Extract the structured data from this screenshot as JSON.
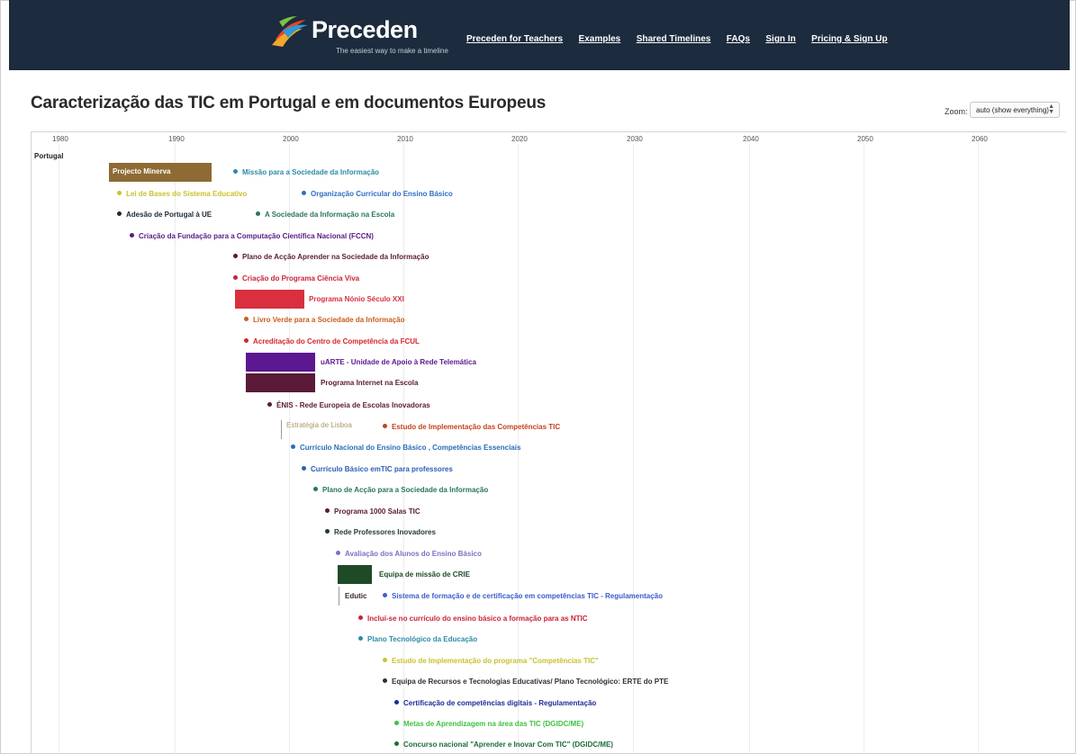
{
  "header": {
    "brand": "Preceden",
    "tagline": "The easiest way to make a timeline",
    "nav": [
      "Preceden for Teachers",
      "Examples",
      "Shared Timelines",
      "FAQs",
      "Sign In",
      "Pricing & Sign Up"
    ]
  },
  "page": {
    "title": "Caracterização das TIC em Portugal e em documentos Europeus",
    "zoom_label": "Zoom:",
    "zoom_value": "auto (show everything)"
  },
  "axis": {
    "ticks": [
      "1980",
      "1990",
      "2000",
      "2010",
      "2020",
      "2030",
      "2040",
      "2050",
      "2060"
    ]
  },
  "lane": "Portugal",
  "events": [
    {
      "label": "Missão para a Sociedade da Informação",
      "color": "#2e8ba8",
      "kind": "point"
    },
    {
      "label": "Lei de Bases do Sistema Educativo",
      "color": "#c8c230",
      "kind": "point"
    },
    {
      "label": "Organização Curricular do Ensino Básico",
      "color": "#2d6fc2",
      "kind": "point"
    },
    {
      "label": "Adesão de Portugal à UE",
      "color": "#1d2a33",
      "kind": "point"
    },
    {
      "label": "A Sociedade da Informação na Escola",
      "color": "#287560",
      "kind": "point"
    },
    {
      "label": "Criação da Fundação para a Computação Científica Nacional (FCCN)",
      "color": "#5b1a86",
      "kind": "point"
    },
    {
      "label": "Plano de Acção Aprender na Sociedade da Informação",
      "color": "#5a1a38",
      "kind": "point"
    },
    {
      "label": "Criação do Programa Ciência Viva",
      "color": "#c9223b",
      "kind": "point"
    },
    {
      "label": "Livro Verde para a Sociedade da Informação",
      "color": "#cc5c1c",
      "kind": "point"
    },
    {
      "label": "Acreditação do Centro de Competência da FCUL",
      "color": "#d8242c",
      "kind": "point"
    },
    {
      "label": "ÉNIS - Rede Europeia de Escolas Inovadoras",
      "color": "#5a1a38",
      "kind": "point"
    },
    {
      "label": "Estudo de Implementação das Competências TIC",
      "color": "#c5431d",
      "kind": "point"
    },
    {
      "label": "Currículo Nacional do Ensino Básico , Competências Essenciais",
      "color": "#2a6cb8",
      "kind": "point"
    },
    {
      "label": "Currículo Básico emTIC para professores",
      "color": "#2a5fb8",
      "kind": "point"
    },
    {
      "label": "Plano de Acção para a Sociedade da Informação",
      "color": "#287560",
      "kind": "point"
    },
    {
      "label": "Programa 1000 Salas TIC",
      "color": "#5a1a38",
      "kind": "point"
    },
    {
      "label": "Rede Professores Inovadores",
      "color": "#1f3d2a",
      "kind": "point"
    },
    {
      "label": "Avaliação dos Alunos do Ensino Básico",
      "color": "#7b6fc4",
      "kind": "point"
    },
    {
      "label": "Sistema de formação e de certificação em competências TIC - Regulamentação",
      "color": "#3a5cc8",
      "kind": "point"
    },
    {
      "label": "Incluí-se no currículo do ensino básico a formação para as NTIC",
      "color": "#c9223b",
      "kind": "point"
    },
    {
      "label": "Plano Tecnológico da Educação",
      "color": "#2e8ba8",
      "kind": "point"
    },
    {
      "label": "Estudo de Implementação do programa \"Competências TIC\"",
      "color": "#c8c230",
      "kind": "point"
    },
    {
      "label": "Equipa de Recursos e Tecnologias Educativas/ Plano Tecnológico: ERTE do PTE",
      "color": "#2f2f2f",
      "kind": "point"
    },
    {
      "label": "Certificação de competências digitais - Regulamentação",
      "color": "#1c2c96",
      "kind": "point"
    },
    {
      "label": "Metas de Aprendizagem na área das TIC (DGIDC/ME)",
      "color": "#3fc242",
      "kind": "point"
    },
    {
      "label": "Concurso nacional \"Aprender e Inovar Com TIC\" (DGIDC/ME)",
      "color": "#1e6b3a",
      "kind": "point"
    }
  ],
  "spans": [
    {
      "label": "Projecto Minerva",
      "color": "#8e6b34"
    },
    {
      "label": "Programa Nónio Século XXI",
      "color": "#d8303f"
    },
    {
      "label": "uARTE - Unidade de Apoio à Rede Telemática",
      "color": "#5b1890"
    },
    {
      "label": "Programa Internet na Escola",
      "color": "#5a1a38"
    },
    {
      "label": "Estratégia de Lisboa",
      "color": "#a49a66"
    },
    {
      "label": "Equipa de missão de CRIE",
      "color": "#1f4a26"
    },
    {
      "label": "Edutic",
      "color": "#3a2a33"
    }
  ]
}
